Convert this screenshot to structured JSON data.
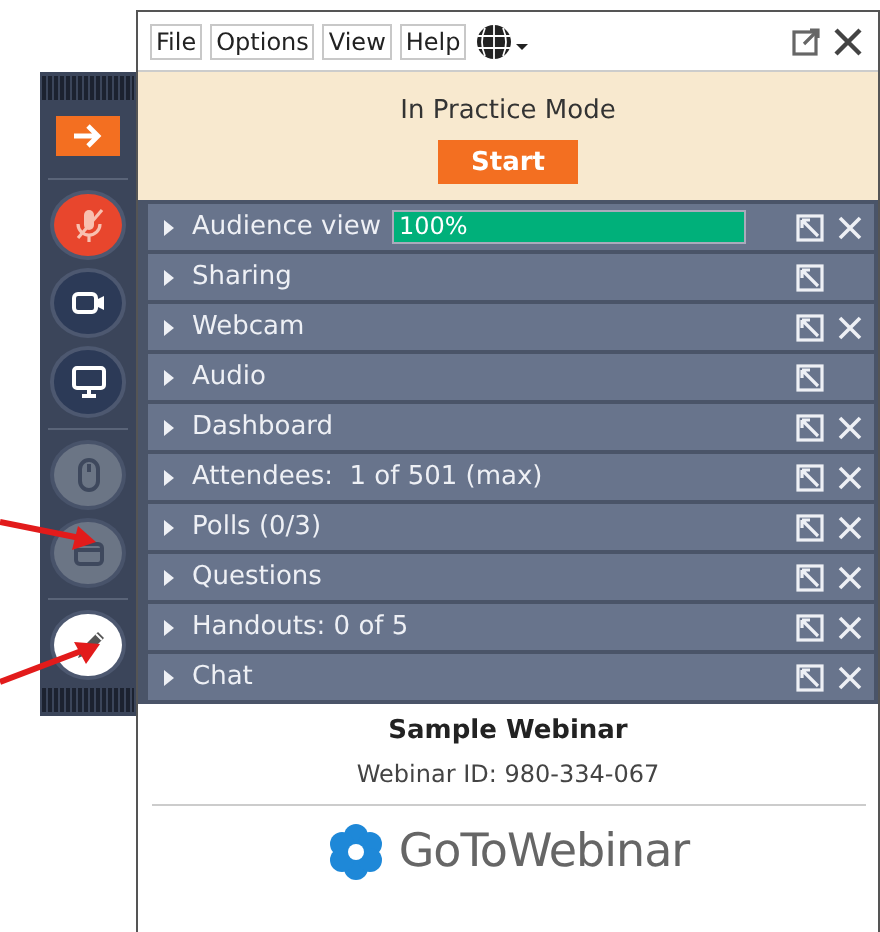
{
  "menu": [
    "File",
    "Options",
    "View",
    "Help"
  ],
  "practice": {
    "status": "In Practice Mode",
    "button": "Start"
  },
  "toolbar": [
    {
      "kind": "arrow",
      "disabled": false
    },
    {
      "kind": "mic",
      "disabled": false
    },
    {
      "kind": "camera",
      "disabled": false
    },
    {
      "kind": "screen",
      "disabled": false
    },
    {
      "kind": "mouse",
      "disabled": true
    },
    {
      "kind": "chat",
      "disabled": true
    },
    {
      "kind": "pen",
      "disabled": false
    }
  ],
  "panes": [
    {
      "label": "Audience view",
      "closable": true,
      "level": 1.0,
      "reading": "100%"
    },
    {
      "label": "Sharing",
      "closable": false
    },
    {
      "label": "Webcam",
      "closable": true
    },
    {
      "label": "Audio",
      "closable": false
    },
    {
      "label": "Dashboard",
      "closable": true
    },
    {
      "label": "Attendees:  1 of 501 (max)",
      "closable": true
    },
    {
      "label": "Polls (0/3)",
      "closable": true
    },
    {
      "label": "Questions",
      "closable": true
    },
    {
      "label": "Handouts: 0 of 5",
      "closable": true
    },
    {
      "label": "Chat",
      "closable": true
    }
  ],
  "webinar": {
    "title": "Sample Webinar",
    "id": "Webinar ID: 980-334-067"
  },
  "brand": "GoToWebinar"
}
